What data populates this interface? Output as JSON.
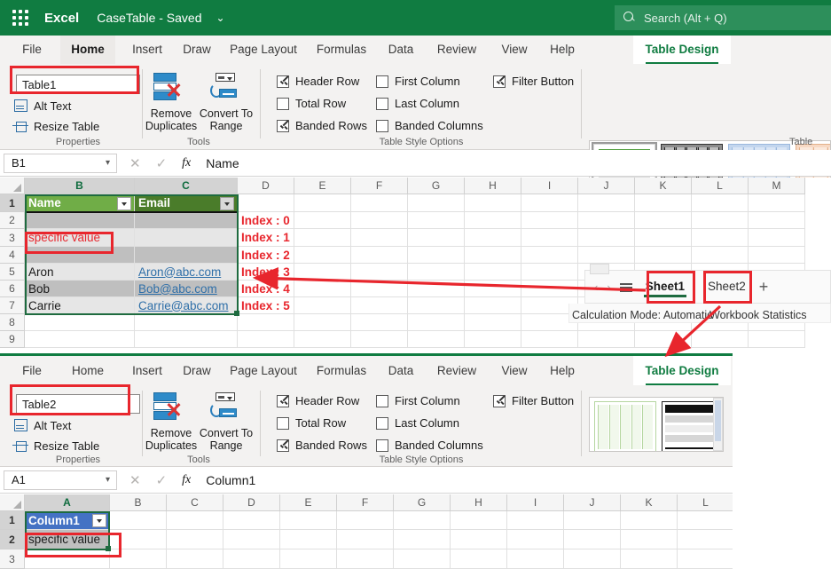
{
  "titlebar": {
    "app_name": "Excel",
    "doc_title": "CaseTable  -  Saved",
    "chevron": "⌄",
    "waffle_icon": "app-launcher-icon",
    "search_placeholder": "Search (Alt + Q)"
  },
  "ribbon_tabs": [
    "File",
    "Home",
    "Insert",
    "Draw",
    "Page Layout",
    "Formulas",
    "Data",
    "Review",
    "View",
    "Help",
    "Table Design"
  ],
  "window1": {
    "active_tab": "Table Design",
    "properties": {
      "table_name_value": "Table1",
      "alt_text_label": "Alt Text",
      "resize_table_label": "Resize Table",
      "group_label": "Properties"
    },
    "tools": {
      "remove_duplicates_label": "Remove\nDuplicates",
      "remove_duplicates_line1": "Remove",
      "remove_duplicates_line2": "Duplicates",
      "convert_to_range_line1": "Convert To",
      "convert_to_range_line2": "Range",
      "group_label": "Tools"
    },
    "style_options": {
      "group_label": "Table Style Options",
      "items": [
        {
          "label": "Header Row",
          "checked": true
        },
        {
          "label": "Total Row",
          "checked": false
        },
        {
          "label": "Banded Rows",
          "checked": true
        },
        {
          "label": "First Column",
          "checked": false
        },
        {
          "label": "Last Column",
          "checked": false
        },
        {
          "label": "Banded Columns",
          "checked": false
        },
        {
          "label": "Filter Button",
          "checked": true
        }
      ]
    },
    "styles_group": {
      "group_label": "Table"
    },
    "formula_bar": {
      "name_box": "B1",
      "cancel_icon": "✕",
      "confirm_icon": "✓",
      "fx_icon": "fx",
      "formula_value": "Name"
    },
    "grid": {
      "columns": [
        "B",
        "C",
        "D",
        "E",
        "F",
        "G",
        "H",
        "I",
        "J",
        "K",
        "L",
        "M"
      ],
      "active_columns": [
        "B",
        "C"
      ],
      "rows": [
        "1",
        "2",
        "3",
        "4",
        "5",
        "6",
        "7",
        "8",
        "9"
      ],
      "active_rows": [
        "1"
      ],
      "table_header": [
        {
          "text": "Name",
          "shade": "light"
        },
        {
          "text": "Email",
          "shade": "dark"
        }
      ],
      "table_rows": [
        {
          "name": "",
          "email": "",
          "banded": true
        },
        {
          "name": "specific value",
          "email": "",
          "banded": false,
          "name_red": true
        },
        {
          "name": "",
          "email": "",
          "banded": true
        },
        {
          "name": "Aron",
          "email": "Aron@abc.com",
          "banded": false
        },
        {
          "name": "Bob",
          "email": "Bob@abc.com",
          "banded": true
        },
        {
          "name": "Carrie",
          "email": "Carrie@abc.com",
          "banded": false
        }
      ],
      "index_labels": [
        "Index : 0",
        "Index : 1",
        "Index : 2",
        "Index : 3",
        "Index : 4",
        "Index : 5"
      ]
    },
    "sheet_bar": {
      "tabs": [
        {
          "label": "Sheet1",
          "active": true
        },
        {
          "label": "Sheet2",
          "active": false
        }
      ],
      "add_sheet_icon": "+",
      "all_sheets_icon": "hamburger-icon",
      "prev_icon": "‹",
      "next_icon": "›",
      "calculation_mode": "Calculation Mode: Automatic",
      "workbook_statistics": "Workbook Statistics"
    }
  },
  "window2": {
    "active_tab": "Table Design",
    "properties": {
      "table_name_value": "Table2",
      "alt_text_label": "Alt Text",
      "resize_table_label": "Resize Table",
      "group_label": "Properties"
    },
    "tools": {
      "remove_duplicates_line1": "Remove",
      "remove_duplicates_line2": "Duplicates",
      "convert_to_range_line1": "Convert To",
      "convert_to_range_line2": "Range",
      "group_label": "Tools"
    },
    "style_options": {
      "group_label": "Table Style Options",
      "items": [
        {
          "label": "Header Row",
          "checked": true
        },
        {
          "label": "Total Row",
          "checked": false
        },
        {
          "label": "Banded Rows",
          "checked": true
        },
        {
          "label": "First Column",
          "checked": false
        },
        {
          "label": "Last Column",
          "checked": false
        },
        {
          "label": "Banded Columns",
          "checked": false
        },
        {
          "label": "Filter Button",
          "checked": true
        }
      ]
    },
    "formula_bar": {
      "name_box": "A1",
      "cancel_icon": "✕",
      "confirm_icon": "✓",
      "fx_icon": "fx",
      "formula_value": "Column1"
    },
    "grid": {
      "columns": [
        "A",
        "B",
        "C",
        "D",
        "E",
        "F",
        "G",
        "H",
        "I",
        "J",
        "K",
        "L"
      ],
      "active_columns": [
        "A"
      ],
      "rows": [
        "1",
        "2",
        "3"
      ],
      "active_rows": [
        "1",
        "2"
      ],
      "header_cell": "Column1",
      "value_cell": "specific value"
    }
  },
  "annotations": {
    "color": "#e8262d",
    "boxes": [
      "table1-name-box",
      "specific-value-cell-w1",
      "sheet1-tab",
      "sheet2-tab",
      "table2-name-box",
      "column1-value-cell-w2"
    ],
    "arrows": [
      "sheet1-to-index3",
      "sheet2-to-window2"
    ]
  }
}
